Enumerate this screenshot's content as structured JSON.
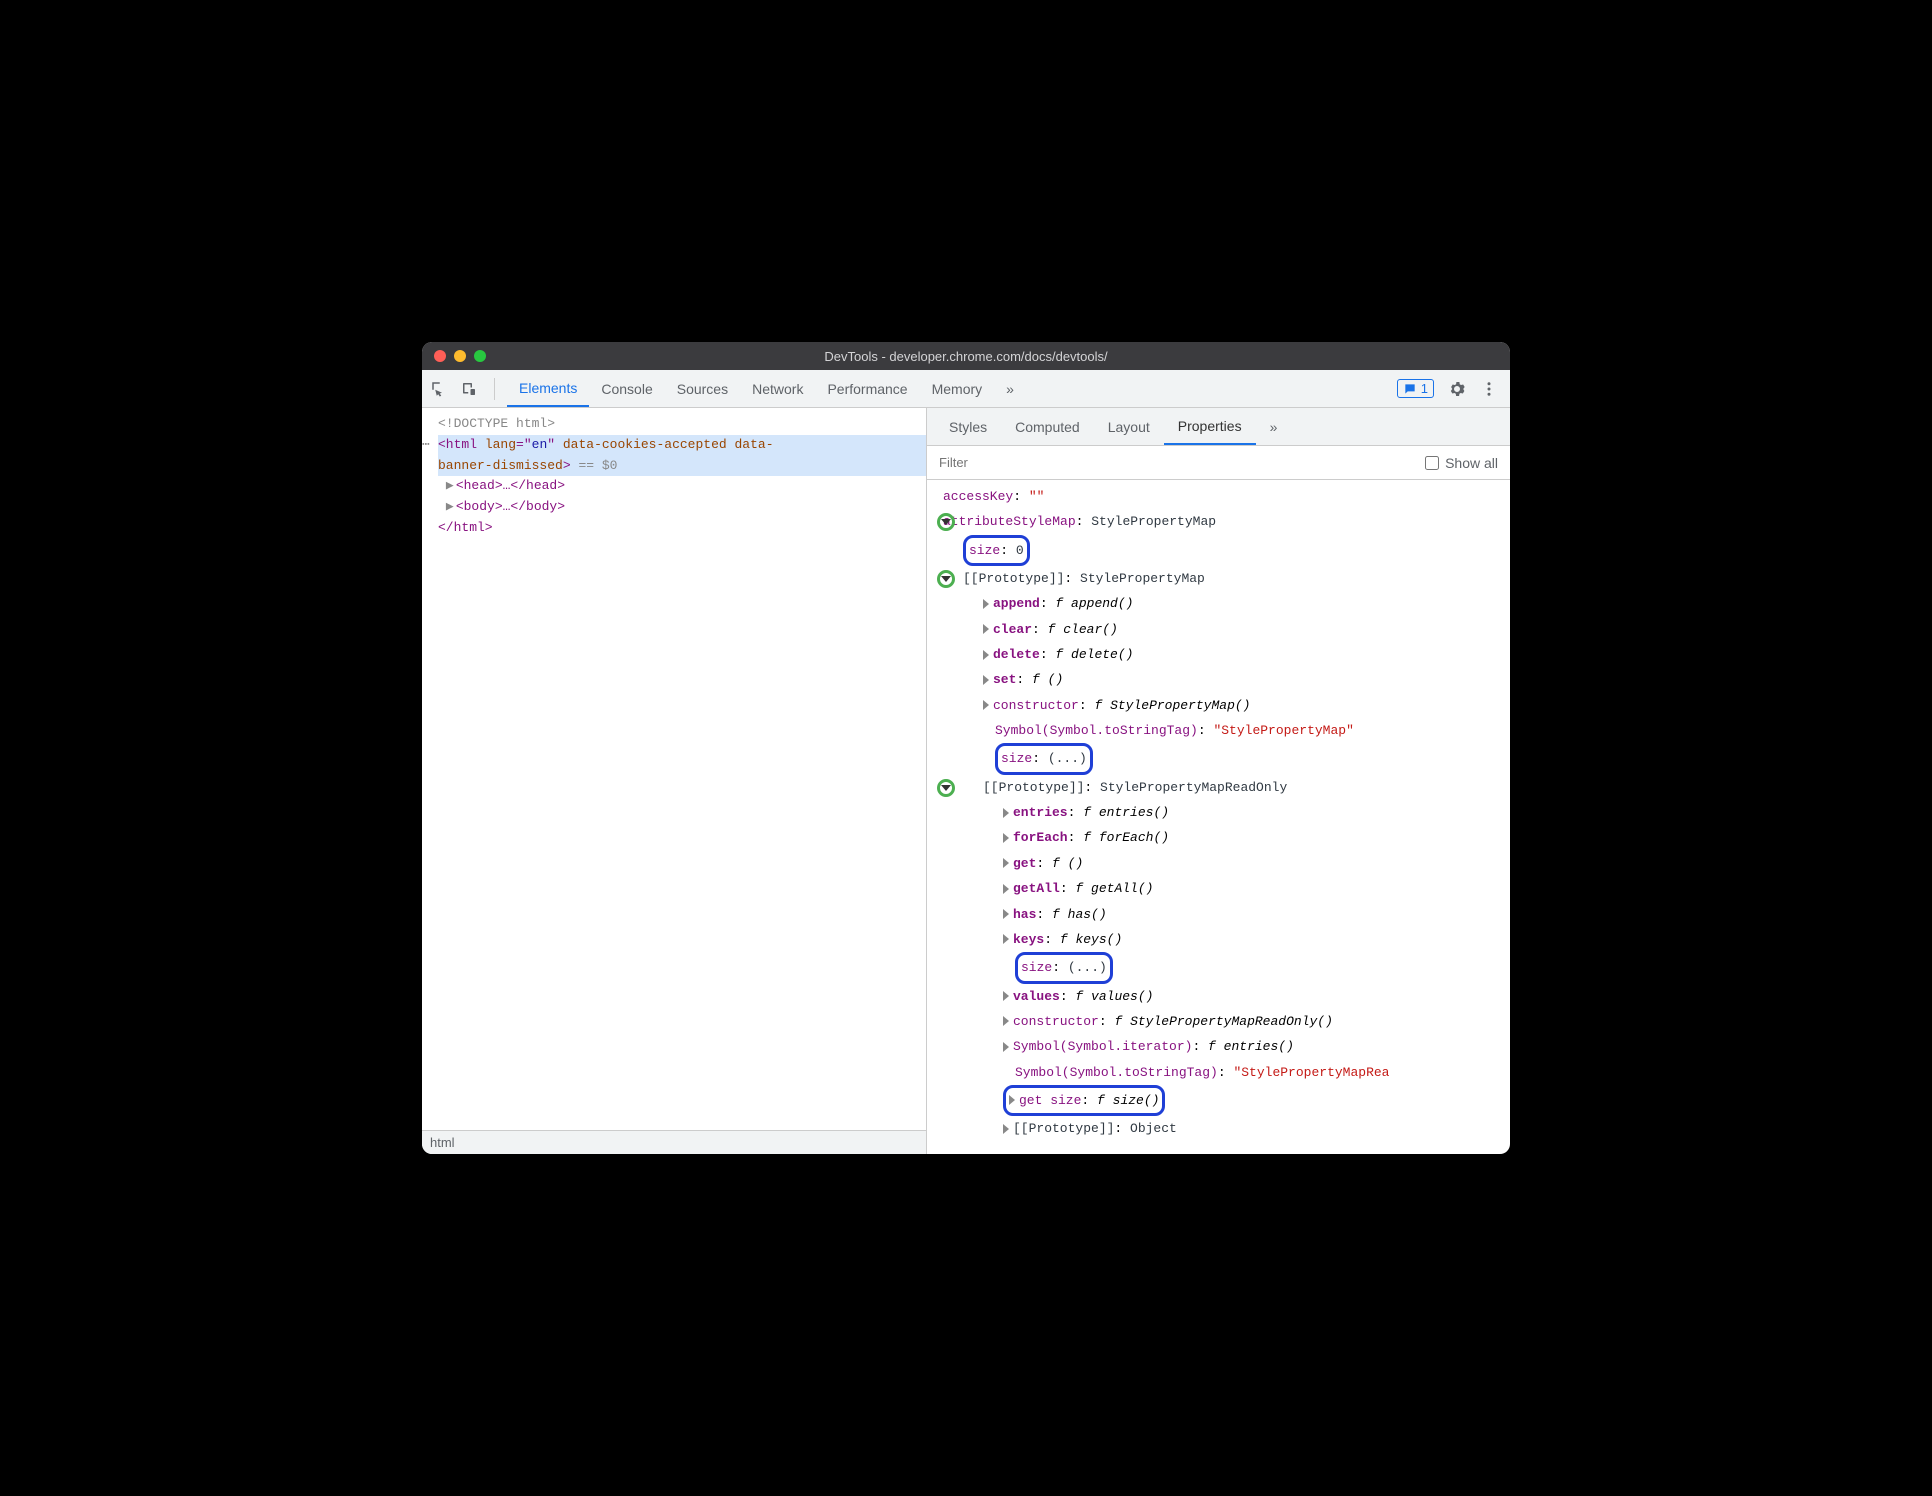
{
  "window": {
    "title": "DevTools - developer.chrome.com/docs/devtools/"
  },
  "toolbar": {
    "tabs": [
      "Elements",
      "Console",
      "Sources",
      "Network",
      "Performance",
      "Memory"
    ],
    "more_tabs_icon": "»",
    "active_tab": "Elements",
    "comment_count": "1"
  },
  "dom": {
    "doctype": "<!DOCTYPE html>",
    "html_open_1": "<html lang=\"en\" data-cookies-accepted data-",
    "html_open_2": "banner-dismissed>",
    "sel_marker": "== $0",
    "head": "<head>…</head>",
    "body": "<body>…</body>",
    "html_close": "</html>",
    "breadcrumb": "html"
  },
  "sidebar": {
    "tabs": [
      "Styles",
      "Computed",
      "Layout",
      "Properties"
    ],
    "more_tabs_icon": "»",
    "active_tab": "Properties",
    "filter_placeholder": "Filter",
    "show_all": "Show all"
  },
  "props": {
    "accessKey": {
      "k": "accessKey",
      "v": "\"\""
    },
    "attrStyleMap": {
      "k": "attributeStyleMap",
      "v": "StylePropertyMap"
    },
    "size0": {
      "k": "size",
      "v": "0"
    },
    "proto1": {
      "k": "[[Prototype]]",
      "v": "StylePropertyMap"
    },
    "append": {
      "k": "append",
      "v": "append()"
    },
    "clear": {
      "k": "clear",
      "v": "clear()"
    },
    "delete": {
      "k": "delete",
      "v": "delete()"
    },
    "set": {
      "k": "set",
      "v": "()"
    },
    "constructor1": {
      "k": "constructor",
      "v": "StylePropertyMap()"
    },
    "symTag1": {
      "k": "Symbol(Symbol.toStringTag)",
      "v": "\"StylePropertyMap\""
    },
    "sizeDots1": {
      "k": "size",
      "v": "(...)"
    },
    "proto2": {
      "k": "[[Prototype]]",
      "v": "StylePropertyMapReadOnly"
    },
    "entries": {
      "k": "entries",
      "v": "entries()"
    },
    "forEach": {
      "k": "forEach",
      "v": "forEach()"
    },
    "get": {
      "k": "get",
      "v": "()"
    },
    "getAll": {
      "k": "getAll",
      "v": "getAll()"
    },
    "has": {
      "k": "has",
      "v": "has()"
    },
    "keys": {
      "k": "keys",
      "v": "keys()"
    },
    "sizeDots2": {
      "k": "size",
      "v": "(...)"
    },
    "values": {
      "k": "values",
      "v": "values()"
    },
    "constructor2": {
      "k": "constructor",
      "v": "StylePropertyMapReadOnly()"
    },
    "symIter": {
      "k": "Symbol(Symbol.iterator)",
      "v": "entries()"
    },
    "symTag2": {
      "k": "Symbol(Symbol.toStringTag)",
      "v": "\"StylePropertyMapRea"
    },
    "getSize": {
      "k": "get size",
      "v": "size()"
    },
    "proto3": {
      "k": "[[Prototype]]",
      "v": "Object"
    }
  },
  "fn": "f"
}
